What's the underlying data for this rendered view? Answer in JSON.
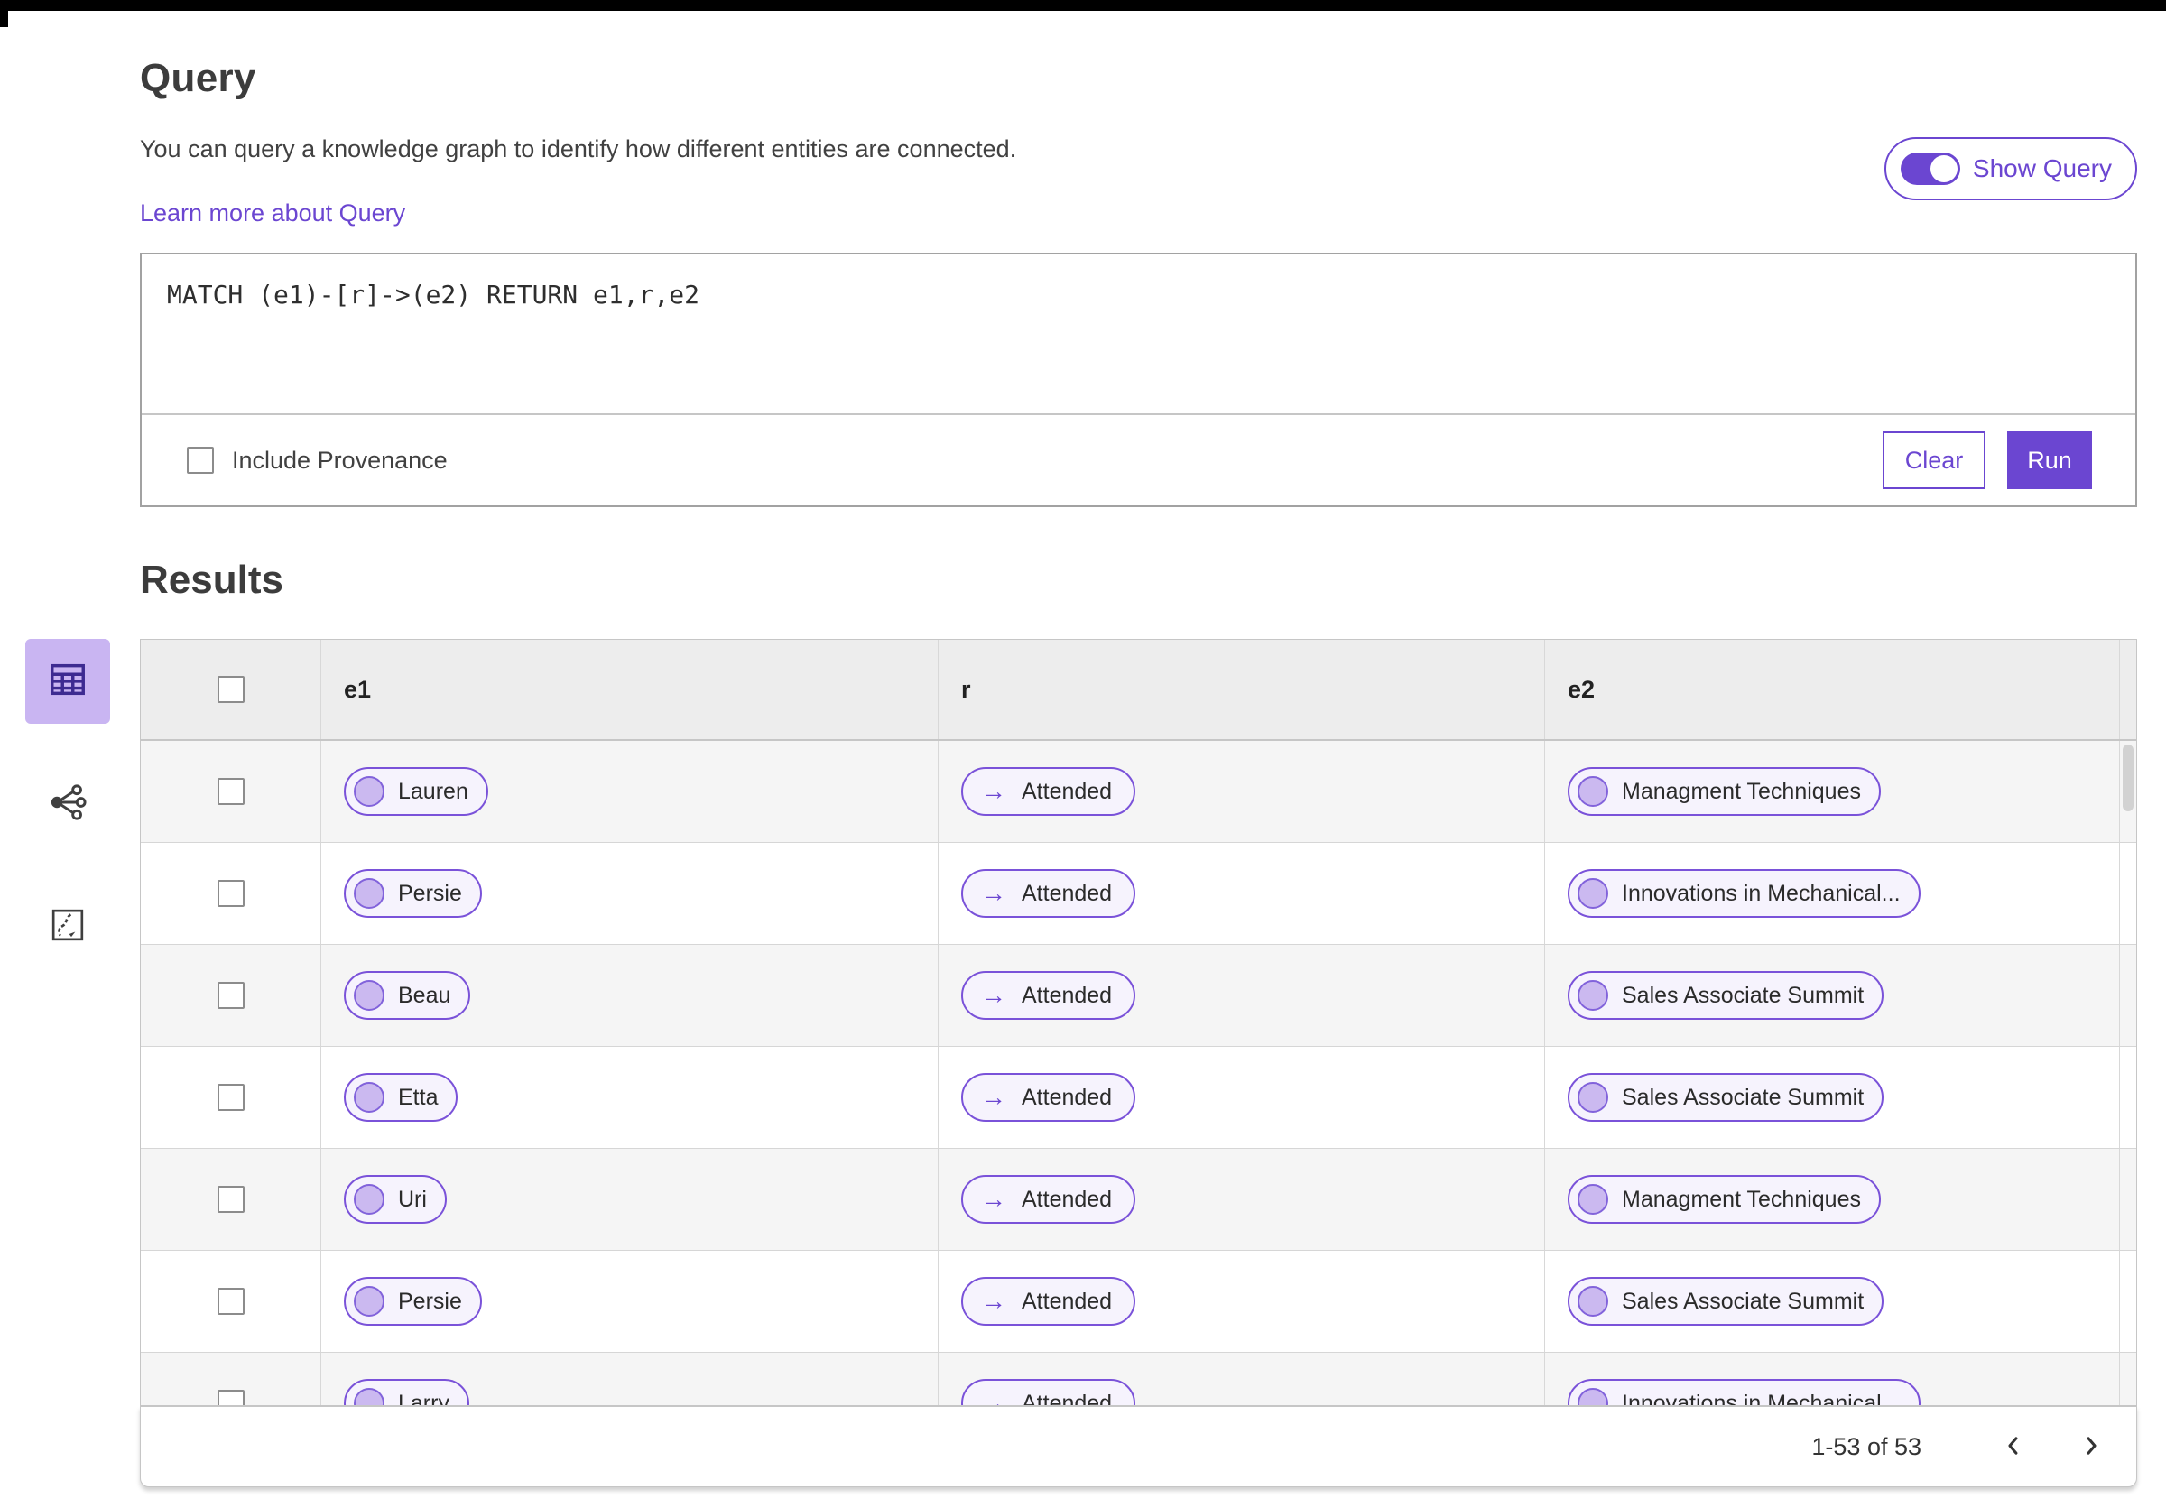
{
  "header": {
    "title": "Query",
    "description": "You can query a knowledge graph to identify how different entities are connected.",
    "learn_more_link": "Learn more about Query",
    "show_query": {
      "label": "Show Query",
      "enabled": true
    }
  },
  "query_editor": {
    "query_text": "MATCH (e1)-[r]->(e2) RETURN e1,r,e2",
    "include_provenance": {
      "label": "Include Provenance",
      "checked": false
    },
    "clear_label": "Clear",
    "run_label": "Run"
  },
  "results": {
    "title": "Results",
    "view_switcher": [
      {
        "icon": "table-view-icon",
        "selected": true
      },
      {
        "icon": "graph-view-icon",
        "selected": false
      },
      {
        "icon": "path-view-icon",
        "selected": false
      }
    ],
    "table": {
      "columns": [
        "e1",
        "r",
        "e2"
      ],
      "relation_arrow": "→",
      "rows": [
        {
          "e1": "Lauren",
          "r": "Attended",
          "e2": "Managment Techniques"
        },
        {
          "e1": "Persie",
          "r": "Attended",
          "e2": "Innovations in Mechanical..."
        },
        {
          "e1": "Beau",
          "r": "Attended",
          "e2": "Sales Associate Summit"
        },
        {
          "e1": "Etta",
          "r": "Attended",
          "e2": "Sales Associate Summit"
        },
        {
          "e1": "Uri",
          "r": "Attended",
          "e2": "Managment Techniques"
        },
        {
          "e1": "Persie",
          "r": "Attended",
          "e2": "Sales Associate Summit"
        },
        {
          "e1": "Larry",
          "r": "Attended",
          "e2": "Innovations in Mechanical..."
        }
      ]
    },
    "pagination": {
      "range_text": "1-53 of 53"
    }
  },
  "colors": {
    "accent": "#6b46d1",
    "pill_border": "#7a52d9",
    "pill_background": "#f6f3fd",
    "node_circle_fill": "#cbb9f0",
    "selected_view_background": "#c9b5f2",
    "table_header_background": "#ededed",
    "row_stripe": "#f5f5f5"
  }
}
